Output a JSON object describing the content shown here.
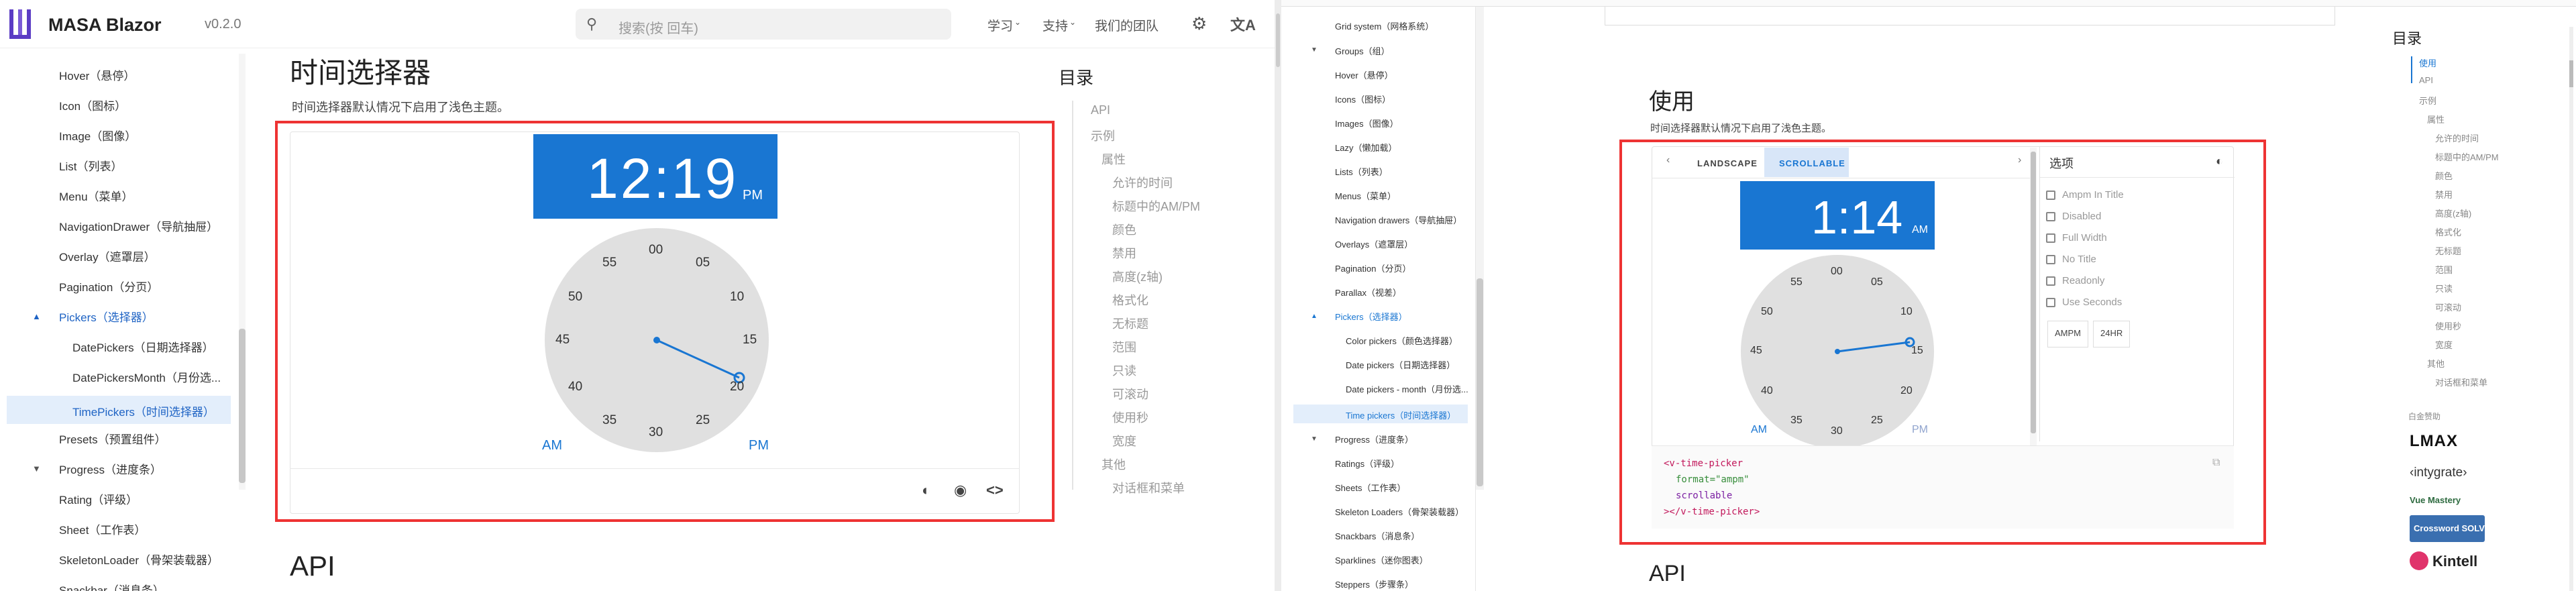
{
  "masa": {
    "brand": "MASA Blazor",
    "version": "v0.2.0",
    "search_placeholder": "搜索(按 回车)",
    "nav": [
      "学习",
      "支持",
      "我们的团队"
    ],
    "sidebar": [
      {
        "label": "Hover（悬停）"
      },
      {
        "label": "Icon（图标）"
      },
      {
        "label": "Image（图像）"
      },
      {
        "label": "List（列表）"
      },
      {
        "label": "Menu（菜单）"
      },
      {
        "label": "NavigationDrawer（导航抽屉）"
      },
      {
        "label": "Overlay（遮罩层）"
      },
      {
        "label": "Pagination（分页）"
      },
      {
        "label": "Pickers（选择器）"
      },
      {
        "label": "DatePickers（日期选择器）"
      },
      {
        "label": "DatePickersMonth（月份选..."
      },
      {
        "label": "TimePickers（时间选择器）"
      },
      {
        "label": "Presets（预置组件）"
      },
      {
        "label": "Progress（进度条）"
      },
      {
        "label": "Rating（评级）"
      },
      {
        "label": "Sheet（工作表）"
      },
      {
        "label": "SkeletonLoader（骨架装载器）"
      },
      {
        "label": "Snackbar（消息条）"
      }
    ],
    "page_title": "时间选择器",
    "page_desc": "时间选择器默认情况下启用了浅色主题。",
    "picker": {
      "time": "12:19",
      "period": "PM",
      "am": "AM",
      "pm": "PM"
    },
    "clock_numbers": [
      "00",
      "05",
      "10",
      "15",
      "20",
      "25",
      "30",
      "35",
      "40",
      "45",
      "50",
      "55"
    ],
    "toc_title": "目录",
    "toc": [
      "API",
      "示例",
      "属性",
      "允许的时间",
      "标题中的AM/PM",
      "颜色",
      "禁用",
      "高度(z轴)",
      "格式化",
      "无标题",
      "范围",
      "只读",
      "可滚动",
      "使用秒",
      "宽度",
      "其他",
      "对话框和菜单"
    ],
    "api_heading": "API"
  },
  "vuetify": {
    "sidebar": [
      {
        "label": "Grid system（网格系统）"
      },
      {
        "label": "Groups（组）"
      },
      {
        "label": "Hover（悬停）"
      },
      {
        "label": "Icons（图标）"
      },
      {
        "label": "Images（图像）"
      },
      {
        "label": "Lazy（懒加载）"
      },
      {
        "label": "Lists（列表）"
      },
      {
        "label": "Menus（菜单）"
      },
      {
        "label": "Navigation drawers（导航抽屉）"
      },
      {
        "label": "Overlays（遮罩层）"
      },
      {
        "label": "Pagination（分页）"
      },
      {
        "label": "Parallax（视差）"
      },
      {
        "label": "Pickers（选择器）"
      },
      {
        "label": "Color pickers（颜色选择器）"
      },
      {
        "label": "Date pickers（日期选择器）"
      },
      {
        "label": "Date pickers - month（月份选..."
      },
      {
        "label": "Time pickers（时间选择器）"
      },
      {
        "label": "Progress（进度条）"
      },
      {
        "label": "Ratings（评级）"
      },
      {
        "label": "Sheets（工作表）"
      },
      {
        "label": "Skeleton Loaders（骨架装载器）"
      },
      {
        "label": "Snackbars（消息条）"
      },
      {
        "label": "Sparklines（迷你图表）"
      },
      {
        "label": "Steppers（步骤条）"
      }
    ],
    "page_title": "使用",
    "page_desc": "时间选择器默认情况下启用了浅色主题。",
    "tabs": [
      "LANDSCAPE",
      "SCROLLABLE"
    ],
    "options_title": "选项",
    "options": [
      "Ampm In Title",
      "Disabled",
      "Full Width",
      "No Title",
      "Readonly",
      "Use Seconds"
    ],
    "buttons": [
      "AMPM",
      "24HR"
    ],
    "picker": {
      "time": "1:14",
      "period": "AM",
      "am": "AM",
      "pm": "PM"
    },
    "clock_numbers": [
      "00",
      "05",
      "10",
      "15",
      "20",
      "25",
      "30",
      "35",
      "40",
      "45",
      "50",
      "55"
    ],
    "code": [
      "<v-time-picker",
      "format=\"ampm\"",
      "scrollable",
      "></v-time-picker>"
    ],
    "api_heading": "API",
    "toc_title": "目录",
    "toc": [
      "使用",
      "API",
      "示例",
      "属性",
      "允许的时间",
      "标题中的AM/PM",
      "颜色",
      "禁用",
      "高度(z轴)",
      "格式化",
      "无标题",
      "范围",
      "只读",
      "可滚动",
      "使用秒",
      "宽度",
      "其他",
      "对话框和菜单"
    ],
    "sponsors_label": "白金赞助",
    "sponsors": [
      "LMAX",
      "‹intygrate›",
      "Vue Mastery",
      "Crossword SOLVER",
      "Kintell"
    ]
  },
  "colors": {
    "accent": "#1976d2",
    "highlight_box": "#e33333"
  }
}
